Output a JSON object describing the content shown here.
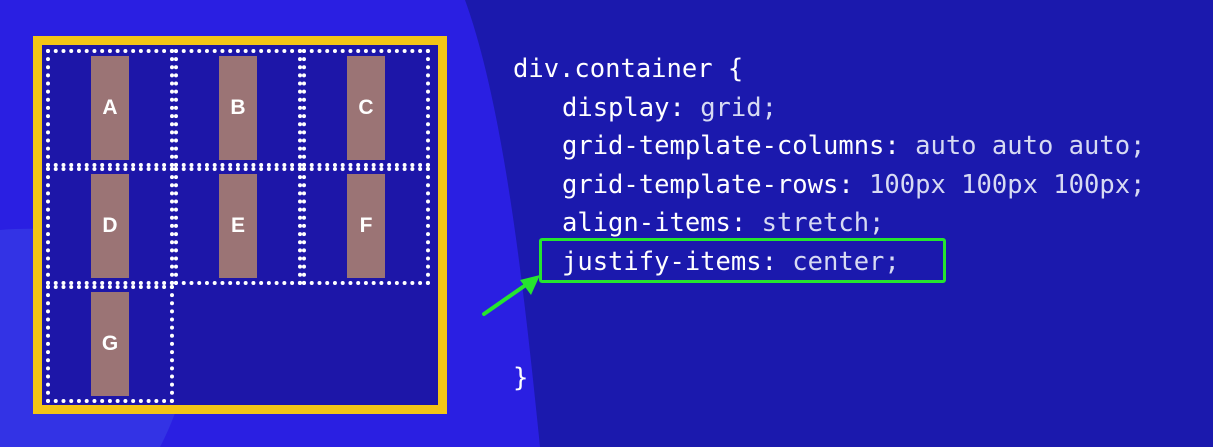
{
  "colors": {
    "background": "#1b19ad",
    "background_shape": "#2a1fe2",
    "grid_border": "#f3c516",
    "item_fill": "#9b7475",
    "highlight": "#25e52f",
    "code_text": "#ffffff"
  },
  "grid": {
    "items": [
      {
        "label": "A"
      },
      {
        "label": "B"
      },
      {
        "label": "C"
      },
      {
        "label": "D"
      },
      {
        "label": "E"
      },
      {
        "label": "F"
      },
      {
        "label": "G"
      }
    ]
  },
  "code": {
    "selector_line": "div.container {",
    "declarations": [
      {
        "property": "display:",
        "value": "grid;"
      },
      {
        "property": "grid-template-columns:",
        "value": "auto auto auto;"
      },
      {
        "property": "grid-template-rows:",
        "value": "100px 100px 100px;"
      },
      {
        "property": "align-items:",
        "value": "stretch;"
      },
      {
        "property": "justify-items:",
        "value": "center;",
        "highlighted": true
      }
    ],
    "closing_brace": "}"
  }
}
